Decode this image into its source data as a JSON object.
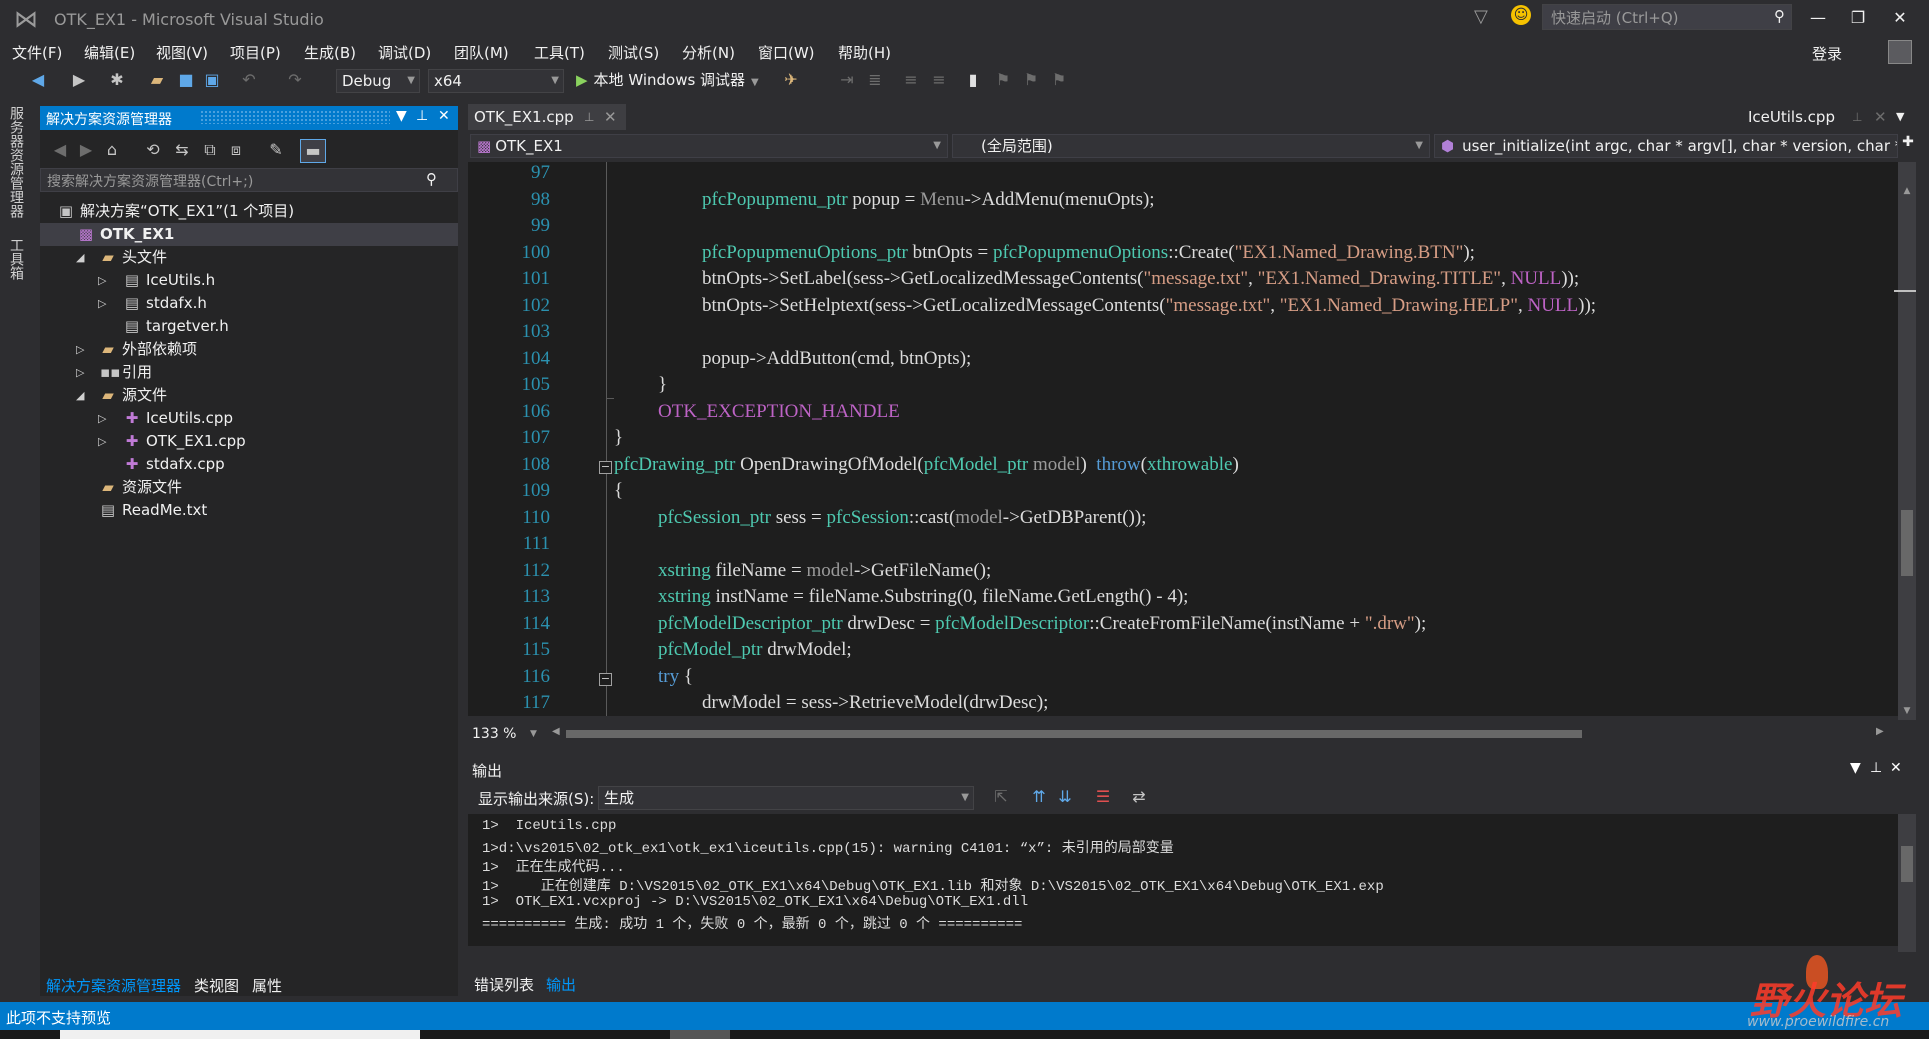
{
  "window": {
    "title": "OTK_EX1 - Microsoft Visual Studio",
    "quick_launch_placeholder": "快速启动 (Ctrl+Q)",
    "login": "登录"
  },
  "menu": [
    "文件(F)",
    "编辑(E)",
    "视图(V)",
    "项目(P)",
    "生成(B)",
    "调试(D)",
    "团队(M)",
    "工具(T)",
    "测试(S)",
    "分析(N)",
    "窗口(W)",
    "帮助(H)"
  ],
  "toolbar": {
    "config": "Debug",
    "platform": "x64",
    "run_label": "本地 Windows 调试器"
  },
  "left_tabs": [
    "服务器资源管理器",
    "工具箱"
  ],
  "solution_explorer": {
    "title": "解决方案资源管理器",
    "search_placeholder": "搜索解决方案资源管理器(Ctrl+;)",
    "tree": [
      {
        "label": "解决方案“OTK_EX1”(1 个项目)",
        "icon": "solution-icon"
      },
      {
        "label": "OTK_EX1",
        "icon": "project-icon"
      },
      {
        "label": "头文件",
        "icon": "folder-icon"
      },
      {
        "label": "IceUtils.h",
        "icon": "header-file-icon"
      },
      {
        "label": "stdafx.h",
        "icon": "header-file-icon"
      },
      {
        "label": "targetver.h",
        "icon": "header-file-icon"
      },
      {
        "label": "外部依赖项",
        "icon": "external-deps-icon"
      },
      {
        "label": "引用",
        "icon": "references-icon"
      },
      {
        "label": "源文件",
        "icon": "folder-icon"
      },
      {
        "label": "IceUtils.cpp",
        "icon": "cpp-file-icon"
      },
      {
        "label": "OTK_EX1.cpp",
        "icon": "cpp-file-icon"
      },
      {
        "label": "stdafx.cpp",
        "icon": "cpp-file-icon"
      },
      {
        "label": "资源文件",
        "icon": "folder-icon"
      },
      {
        "label": "ReadMe.txt",
        "icon": "text-file-icon"
      }
    ],
    "bottom_tabs": [
      "解决方案资源管理器",
      "类视图",
      "属性"
    ]
  },
  "editor": {
    "active_tab": "OTK_EX1.cpp",
    "right_tab": "IceUtils.cpp",
    "nav_project": "OTK_EX1",
    "nav_scope": "(全局范围)",
    "nav_member": "user_initialize(int argc, char * argv[], char * version, char * bu",
    "zoom": "133 %",
    "line_numbers": [
      "97",
      "98",
      "99",
      "100",
      "101",
      "102",
      "103",
      "104",
      "105",
      "106",
      "107",
      "108",
      "109",
      "110",
      "111",
      "112",
      "113",
      "114",
      "115",
      "116",
      "117"
    ]
  },
  "output": {
    "title": "输出",
    "source_label": "显示输出来源(S):",
    "source_value": "生成",
    "lines": [
      "1>  IceUtils.cpp",
      "1>d:\\vs2015\\02_otk_ex1\\otk_ex1\\iceutils.cpp(15): warning C4101: “x”: 未引用的局部变量",
      "1>  正在生成代码...",
      "1>     正在创建库 D:\\VS2015\\02_OTK_EX1\\x64\\Debug\\OTK_EX1.lib 和对象 D:\\VS2015\\02_OTK_EX1\\x64\\Debug\\OTK_EX1.exp",
      "1>  OTK_EX1.vcxproj -> D:\\VS2015\\02_OTK_EX1\\x64\\Debug\\OTK_EX1.dll",
      "========== 生成: 成功 1 个，失败 0 个，最新 0 个，跳过 0 个 =========="
    ],
    "tabs": [
      "错误列表",
      "输出"
    ]
  },
  "status": {
    "text": "此项不支持预览"
  },
  "watermark": {
    "text": "野火论坛",
    "url": "www.proewildfire.cn"
  },
  "colors": {
    "accent": "#007acc",
    "background": "#2d2d30",
    "editor_bg": "#1e1e1e",
    "line_number": "#2b91af",
    "keyword": "#569cd6",
    "type": "#4ec9b0",
    "string": "#d69d85",
    "macro": "#bd63c5"
  }
}
